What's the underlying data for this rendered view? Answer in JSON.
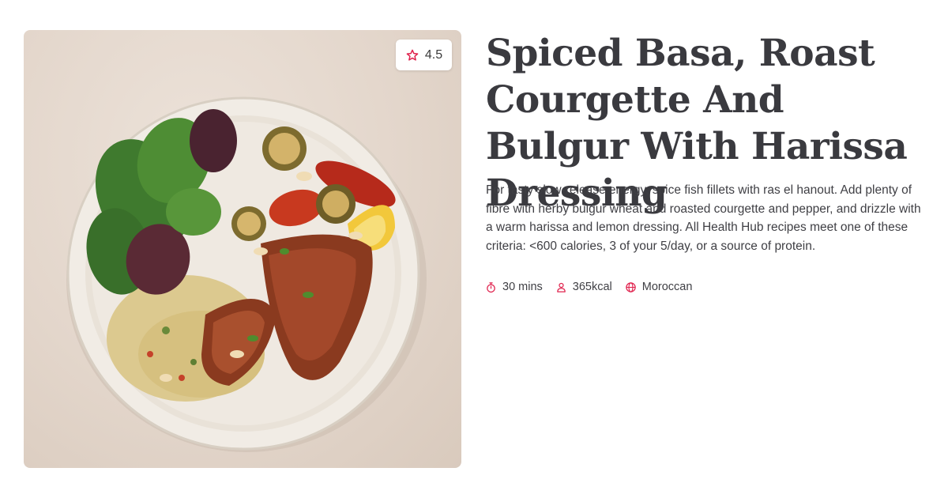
{
  "recipe": {
    "title": "Spiced Basa, Roast Courgette And Bulgur With Harissa Dressing",
    "description": "For tasty slow-release energy, spice fish fillets with ras el hanout. Add plenty of fibre with herby bulgur wheat and roasted courgette and pepper, and drizzle with a warm harissa and lemon dressing. All Health Hub recipes meet one of these criteria: <600 calories, 3 of your 5/day, or a source of protein.",
    "rating": "4.5",
    "meta": {
      "time": "30 mins",
      "calories": "365kcal",
      "cuisine": "Moroccan"
    }
  },
  "icons": {
    "rating": "star-icon",
    "time": "stopwatch-icon",
    "calories": "person-icon",
    "cuisine": "globe-icon"
  },
  "colors": {
    "accent": "#e0234e",
    "title_text": "#3a3a3f",
    "body_text": "#3f3f44"
  }
}
